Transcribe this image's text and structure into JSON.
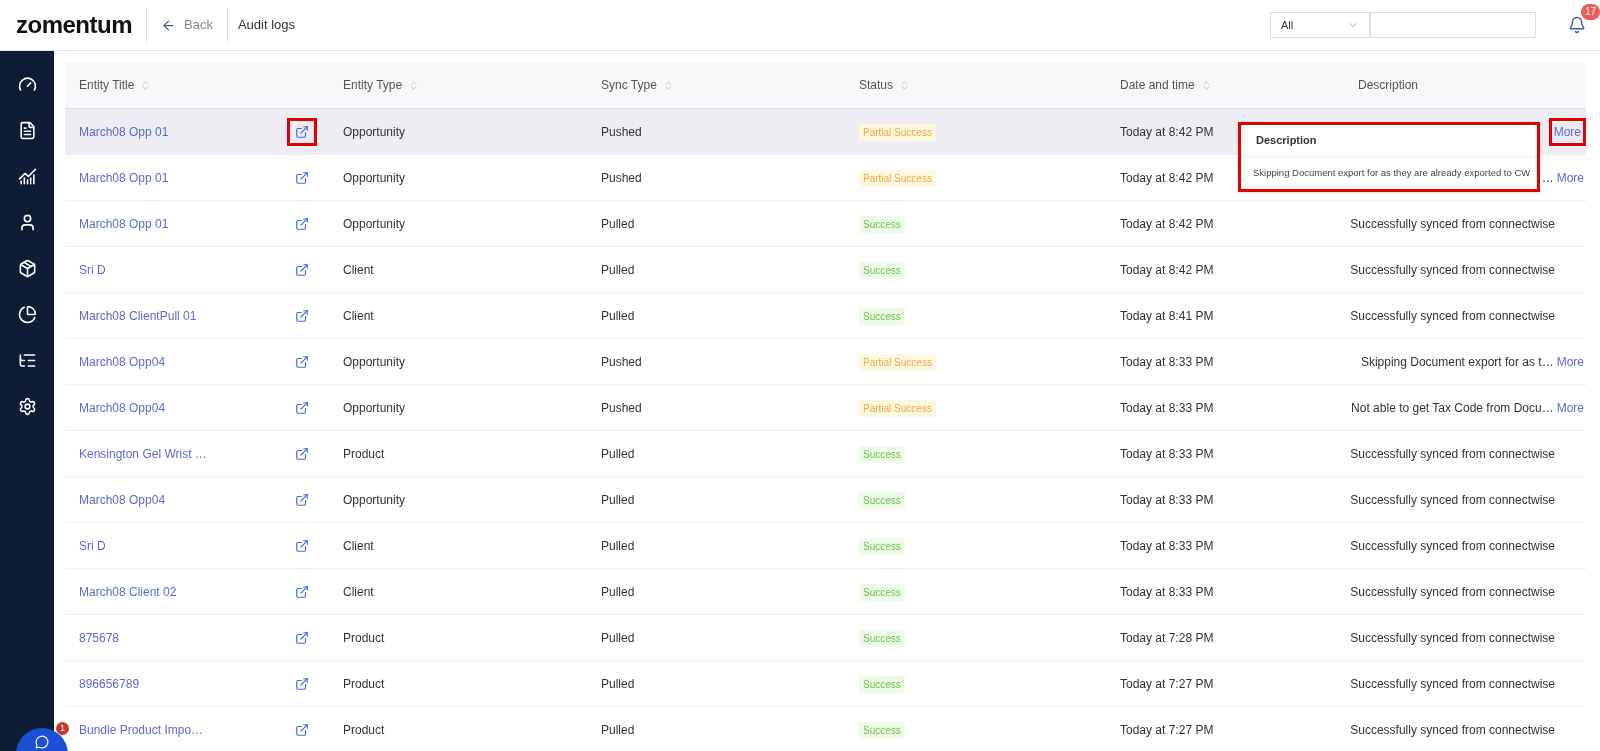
{
  "header": {
    "logo": "zomentum",
    "back": "Back",
    "title": "Audit logs",
    "filter": {
      "value": "All"
    },
    "notifications": "17"
  },
  "chat": {
    "badge": "1"
  },
  "table": {
    "columns": [
      {
        "label": "Entity Title",
        "sortable": true
      },
      {
        "label": "Entity Type",
        "sortable": true
      },
      {
        "label": "Sync Type",
        "sortable": true
      },
      {
        "label": "Status",
        "sortable": true
      },
      {
        "label": "Date and time",
        "sortable": true
      },
      {
        "label": "Description",
        "sortable": false
      }
    ],
    "rows": [
      {
        "title": "March08 Opp 01",
        "type": "Opportunity",
        "sync": "Pushed",
        "status": {
          "label": "Partial Success",
          "kind": "partial"
        },
        "date": "Today at 8:42 PM",
        "more": "More",
        "selected": true,
        "marked": true
      },
      {
        "title": "March08 Opp 01",
        "type": "Opportunity",
        "sync": "Pushed",
        "status": {
          "label": "Partial Success",
          "kind": "partial"
        },
        "date": "Today at 8:42 PM",
        "description": "…",
        "more": "More",
        "selected": false,
        "marked": false
      },
      {
        "title": "March08 Opp 01",
        "type": "Opportunity",
        "sync": "Pulled",
        "status": {
          "label": "Success",
          "kind": "success"
        },
        "date": "Today at 8:42 PM",
        "description": "Successfully synced from connectwise",
        "selected": false,
        "marked": false
      },
      {
        "title": "Sri  D",
        "type": "Client",
        "sync": "Pulled",
        "status": {
          "label": "Success",
          "kind": "success"
        },
        "date": "Today at 8:42 PM",
        "description": "Successfully synced from connectwise",
        "selected": false,
        "marked": false
      },
      {
        "title": "March08 ClientPull 01",
        "type": "Client",
        "sync": "Pulled",
        "status": {
          "label": "Success",
          "kind": "success"
        },
        "date": "Today at 8:41 PM",
        "description": "Successfully synced from connectwise",
        "selected": false,
        "marked": false
      },
      {
        "title": "March08 Opp04",
        "type": "Opportunity",
        "sync": "Pushed",
        "status": {
          "label": "Partial Success",
          "kind": "partial"
        },
        "date": "Today at 8:33 PM",
        "description": "Skipping Document export for  as t…",
        "more": "More",
        "selected": false,
        "marked": false
      },
      {
        "title": "March08 Opp04",
        "type": "Opportunity",
        "sync": "Pushed",
        "status": {
          "label": "Partial Success",
          "kind": "partial"
        },
        "date": "Today at 8:33 PM",
        "description": "Not able to get Tax Code from Docu…",
        "more": "More",
        "selected": false,
        "marked": false
      },
      {
        "title": "Kensington Gel Wrist …",
        "type": "Product",
        "sync": "Pulled",
        "status": {
          "label": "Success",
          "kind": "success"
        },
        "date": "Today at 8:33 PM",
        "description": "Successfully synced from connectwise",
        "selected": false,
        "marked": false
      },
      {
        "title": "March08 Opp04",
        "type": "Opportunity",
        "sync": "Pulled",
        "status": {
          "label": "Success",
          "kind": "success"
        },
        "date": "Today at 8:33 PM",
        "description": "Successfully synced from connectwise",
        "selected": false,
        "marked": false
      },
      {
        "title": "Sri D",
        "type": "Client",
        "sync": "Pulled",
        "status": {
          "label": "Success",
          "kind": "success"
        },
        "date": "Today at 8:33 PM",
        "description": "Successfully synced from connectwise",
        "selected": false,
        "marked": false
      },
      {
        "title": "March08 Client 02",
        "type": "Client",
        "sync": "Pulled",
        "status": {
          "label": "Success",
          "kind": "success"
        },
        "date": "Today at 8:33 PM",
        "description": "Successfully synced from connectwise",
        "selected": false,
        "marked": false
      },
      {
        "title": "875678",
        "type": "Product",
        "sync": "Pulled",
        "status": {
          "label": "Success",
          "kind": "success"
        },
        "date": "Today at 7:28 PM",
        "description": "Successfully synced from connectwise",
        "selected": false,
        "marked": false
      },
      {
        "title": "896656789",
        "type": "Product",
        "sync": "Pulled",
        "status": {
          "label": "Success",
          "kind": "success"
        },
        "date": "Today at 7:27 PM",
        "description": "Successfully synced from connectwise",
        "selected": false,
        "marked": false
      },
      {
        "title": "Bundle Product Impo…",
        "type": "Product",
        "sync": "Pulled",
        "status": {
          "label": "Success",
          "kind": "success"
        },
        "date": "Today at 7:27 PM",
        "description": "Successfully synced from connectwise",
        "selected": false,
        "marked": false
      }
    ]
  },
  "popover": {
    "title": "Description",
    "text": "Skipping Document export for as they are already exported to CW",
    "marked": true
  }
}
